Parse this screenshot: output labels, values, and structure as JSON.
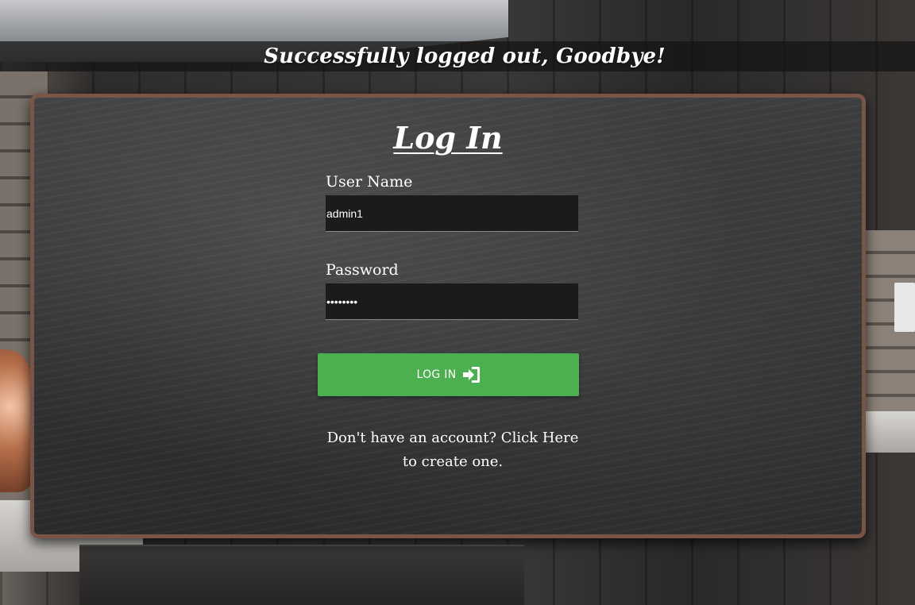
{
  "flash": {
    "message": "Successfully logged out, Goodbye!"
  },
  "login": {
    "title": "Log In",
    "username_label": "User Name",
    "username_value": "admin1",
    "password_label": "Password",
    "password_value": "••••••••",
    "submit_label": "LOG IN",
    "submit_icon": "sign-in-icon"
  },
  "signup": {
    "prefix": "Don't have an account? ",
    "link_text": "Click Here",
    "suffix": " to create one."
  },
  "colors": {
    "button_green": "#4caf50",
    "board_frame": "#7a5446",
    "input_bg": "#1b1b1b"
  }
}
